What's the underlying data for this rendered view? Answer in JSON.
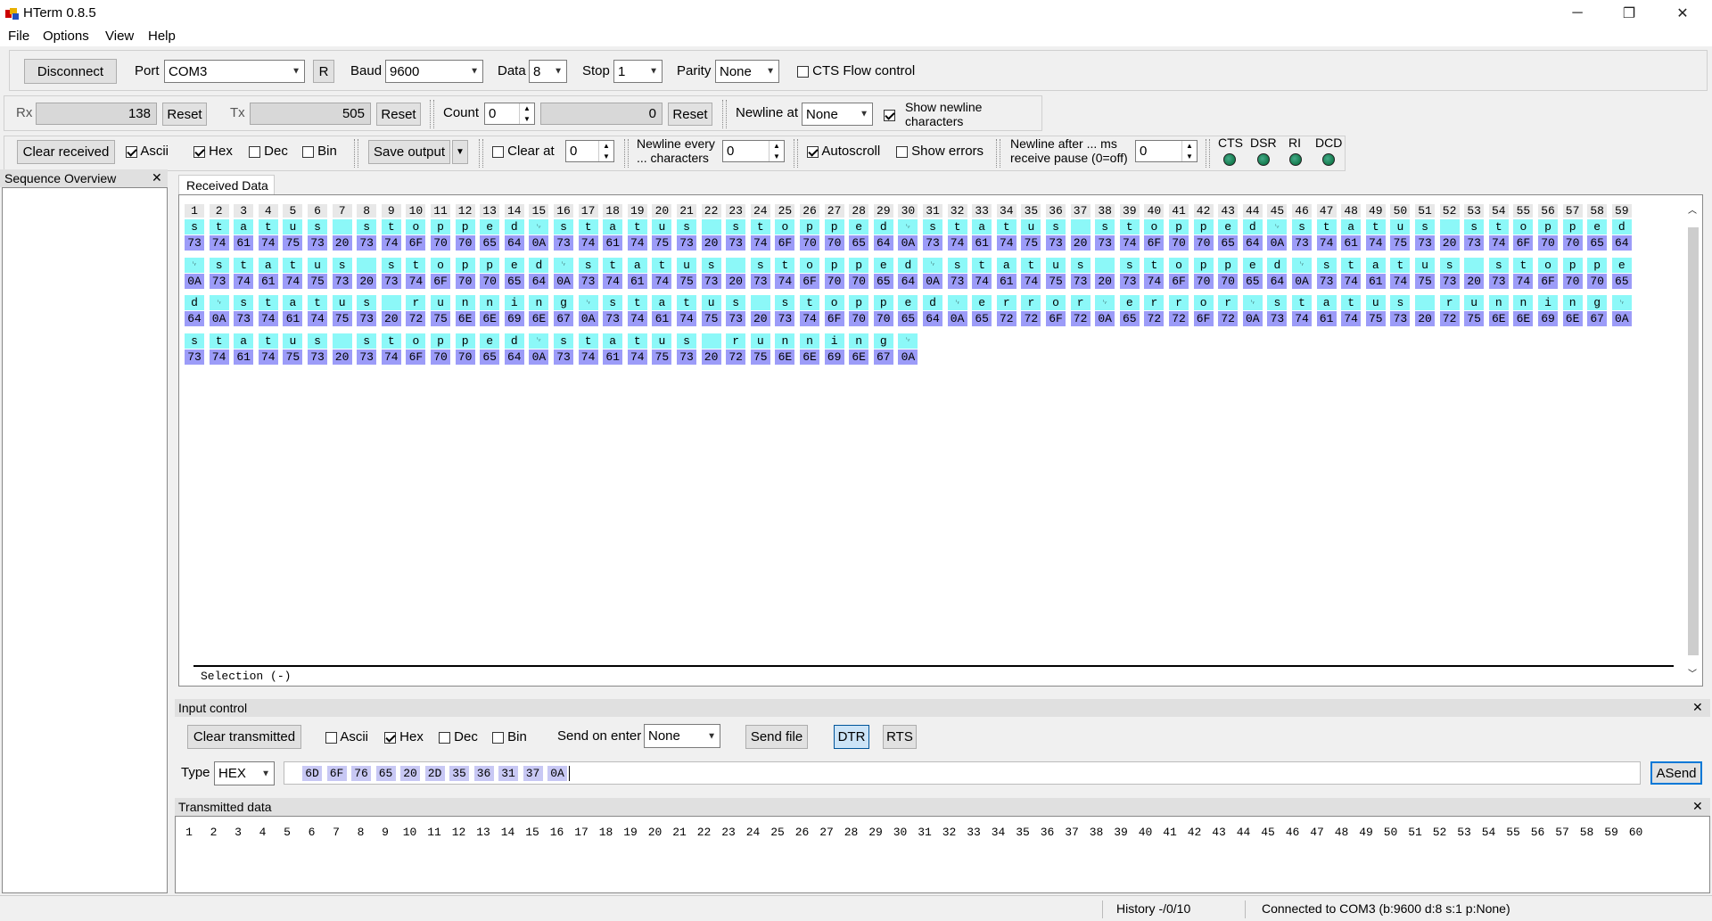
{
  "window": {
    "title": "HTerm 0.8.5",
    "minimize_glyph": "─",
    "maximize_glyph": "❐",
    "close_glyph": "✕"
  },
  "menu": [
    "File",
    "Options",
    "View",
    "Help"
  ],
  "connection": {
    "disconnect_label": "Disconnect",
    "port_label": "Port",
    "port_value": "COM3",
    "r_label": "R",
    "baud_label": "Baud",
    "baud_value": "9600",
    "data_label": "Data",
    "data_value": "8",
    "stop_label": "Stop",
    "stop_value": "1",
    "parity_label": "Parity",
    "parity_value": "None",
    "cts_label": "CTS Flow control",
    "cts_checked": false
  },
  "counters": {
    "rx_label": "Rx",
    "rx_value": "138",
    "rx_reset": "Reset",
    "tx_label": "Tx",
    "tx_value": "505",
    "tx_reset": "Reset",
    "count_label": "Count",
    "count_value": "0",
    "count_result": "0",
    "count_reset": "Reset",
    "newline_at_label": "Newline at",
    "newline_at_value": "None",
    "show_newline_label": "Show newline characters",
    "show_newline_checked": true
  },
  "display_toolbar": {
    "clear_received": "Clear received",
    "ascii": "Ascii",
    "hex": "Hex",
    "dec": "Dec",
    "bin": "Bin",
    "save_output": "Save output",
    "clear_at": "Clear at",
    "clear_at_value": "0",
    "newline_every": "Newline every ... characters",
    "newline_every_value": "0",
    "autoscroll": "Autoscroll",
    "show_errors": "Show errors",
    "newline_after": "Newline after ... ms receive pause (0=off)",
    "newline_after_value": "0",
    "leds": [
      "CTS",
      "DSR",
      "RI",
      "DCD"
    ]
  },
  "sequence_overview": {
    "title": "Sequence Overview",
    "close": "✕"
  },
  "received": {
    "tab": "Received Data",
    "selection": "Selection (-)",
    "column_count": 59,
    "text": "status stopped\nstatus stopped\nstatus stopped\nstatus stopped\nstatus stopped\nstatus stopped\nstatus stopped\nstatus stopped\nstatus running\nstatus stopped\nerror\nerror\nstatus running\nstatus stopped\nstatus running\n"
  },
  "input_control": {
    "title": "Input control",
    "close": "✕",
    "clear_transmitted": "Clear transmitted",
    "ascii": "Ascii",
    "hex": "Hex",
    "dec": "Dec",
    "bin": "Bin",
    "send_on_enter_label": "Send on enter",
    "send_on_enter_value": "None",
    "send_file": "Send file",
    "dtr": "DTR",
    "rts": "RTS",
    "type_label": "Type",
    "type_value": "HEX",
    "input_bytes": [
      "6D",
      "6F",
      "76",
      "65",
      "20",
      "2D",
      "35",
      "36",
      "31",
      "37",
      "0A"
    ],
    "asend": "ASend"
  },
  "transmitted": {
    "title": "Transmitted data",
    "close": "✕",
    "column_count": 60
  },
  "status": {
    "history": "History -/0/10",
    "connection": "Connected to COM3 (b:9600 d:8 s:1 p:None)"
  },
  "colors": {
    "ascii_cell": "#8cf8f8",
    "hex_cell": "#9c9cf8",
    "dtr_active": "#cce4f7"
  }
}
